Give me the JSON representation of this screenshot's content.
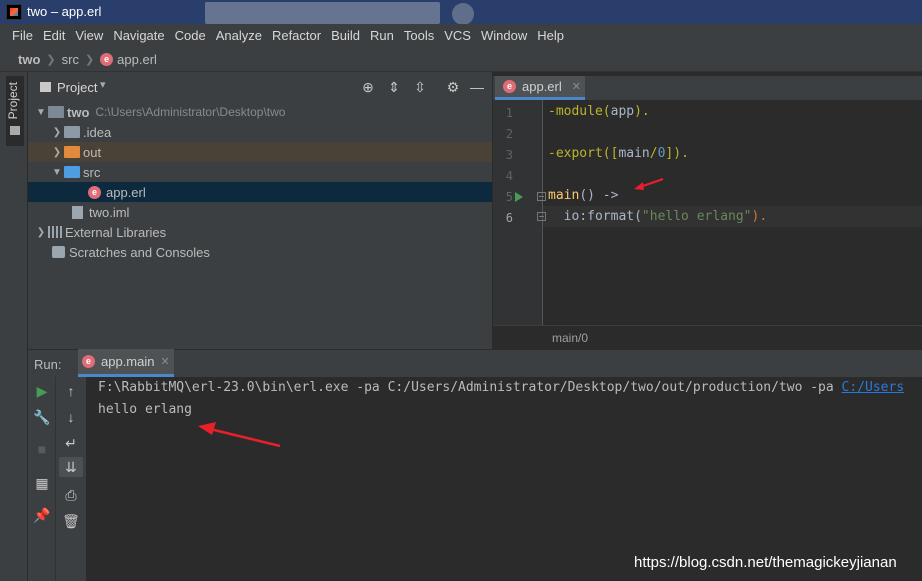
{
  "window": {
    "title": "two – app.erl"
  },
  "menu": [
    "File",
    "Edit",
    "View",
    "Navigate",
    "Code",
    "Analyze",
    "Refactor",
    "Build",
    "Run",
    "Tools",
    "VCS",
    "Window",
    "Help"
  ],
  "breadcrumb": [
    "two",
    "src",
    "app.erl"
  ],
  "left_stripe": {
    "project_label": "Project"
  },
  "project_panel": {
    "title": "Project",
    "tree": [
      {
        "label": "two",
        "path": "C:\\Users\\Administrator\\Desktop\\two"
      },
      {
        "label": ".idea"
      },
      {
        "label": "out"
      },
      {
        "label": "src"
      },
      {
        "label": "app.erl"
      },
      {
        "label": "two.iml"
      },
      {
        "label": "External Libraries"
      },
      {
        "label": "Scratches and Consoles"
      }
    ]
  },
  "editor": {
    "tab": "app.erl",
    "line_numbers": [
      "1",
      "2",
      "3",
      "4",
      "5",
      "6"
    ],
    "code": {
      "l1_a": "-module(",
      "l1_b": "app",
      "l1_c": ").",
      "l3_a": "-export([",
      "l3_b": "main",
      "l3_c": "/",
      "l3_d": "0",
      "l3_e": "]).",
      "l5_a": "main",
      "l5_b": "() ->",
      "l6_a": "  io:format(",
      "l6_b": "\"hello erlang\"",
      "l6_c": ")."
    },
    "breadcrumb": "main/0"
  },
  "run_panel": {
    "label": "Run:",
    "tab": "app.main",
    "console": {
      "command": "F:\\RabbitMQ\\erl-23.0\\bin\\erl.exe -pa C:/Users/Administrator/Desktop/two/out/production/two -pa ",
      "command_link": "C:/Users",
      "output": "hello erlang"
    }
  },
  "watermark": "https://blog.csdn.net/themagickeyjianan",
  "colors": {
    "accent": "#4a88c7",
    "background": "#2b2b2b",
    "panel": "#3c3f41",
    "annotation_arrow": "#e8202a"
  }
}
